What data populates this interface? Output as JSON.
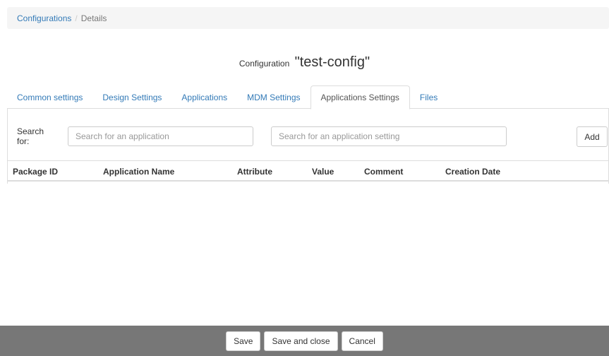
{
  "breadcrumb": {
    "link": "Configurations",
    "separator": "/",
    "current": "Details"
  },
  "title": {
    "prefix": "Configuration",
    "name": "\"test-config\""
  },
  "tabs": [
    {
      "label": "Common settings",
      "active": false
    },
    {
      "label": "Design Settings",
      "active": false
    },
    {
      "label": "Applications",
      "active": false
    },
    {
      "label": "MDM Settings",
      "active": false
    },
    {
      "label": "Applications Settings",
      "active": true
    },
    {
      "label": "Files",
      "active": false
    }
  ],
  "search": {
    "label": "Search for:",
    "app_placeholder": "Search for an application",
    "setting_placeholder": "Search for an application setting",
    "add_label": "Add"
  },
  "table": {
    "columns": [
      "Package ID",
      "Application Name",
      "Attribute",
      "Value",
      "Comment",
      "Creation Date"
    ],
    "rows": []
  },
  "footer": {
    "save_label": "Save",
    "save_close_label": "Save and close",
    "cancel_label": "Cancel"
  },
  "colors": {
    "link": "#337ab7",
    "footer_bg": "#777777"
  }
}
